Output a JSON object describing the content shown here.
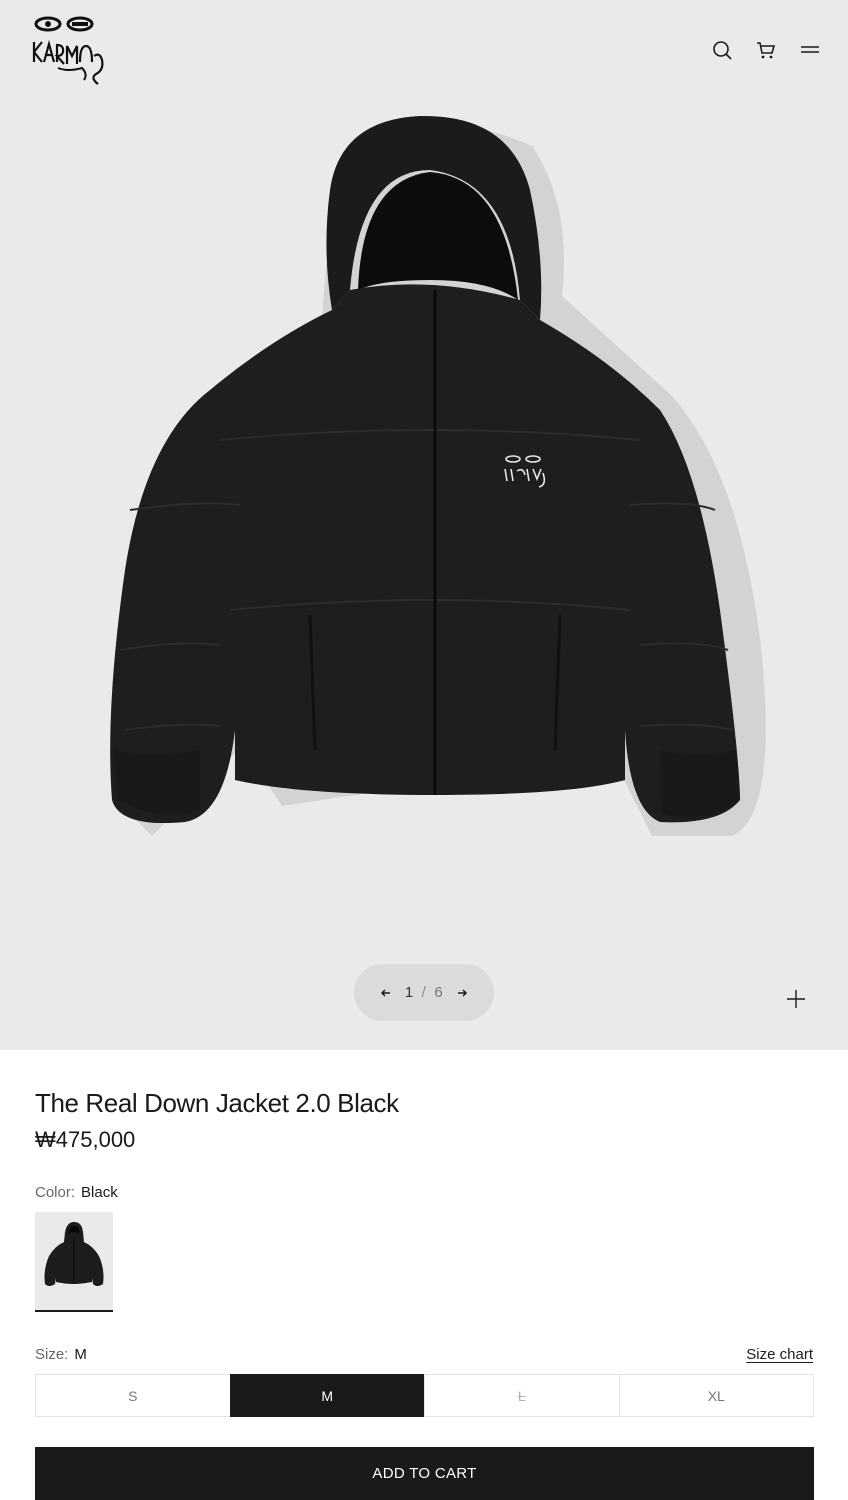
{
  "brand": {
    "logo_text": "KARMA",
    "logo_icon": "eyes-hand-logo-icon"
  },
  "header": {
    "icons": [
      "search-icon",
      "cart-icon",
      "menu-icon"
    ]
  },
  "gallery": {
    "current": "1",
    "separator": "/",
    "total": "6",
    "prev_icon": "arrow-left-icon",
    "next_icon": "arrow-right-icon",
    "zoom_icon": "plus-icon"
  },
  "product": {
    "title": "The Real Down Jacket 2.0 Black",
    "price": "₩475,000"
  },
  "color": {
    "label": "Color:",
    "value": "Black"
  },
  "size": {
    "label": "Size:",
    "value": "M",
    "chart_link": "Size chart",
    "options": [
      {
        "label": "S",
        "state": "available"
      },
      {
        "label": "M",
        "state": "selected"
      },
      {
        "label": "L",
        "state": "sold-out"
      },
      {
        "label": "XL",
        "state": "available"
      }
    ]
  },
  "cta": {
    "add_to_cart": "ADD TO CART"
  },
  "colors": {
    "accent": "#1a1a1a",
    "hero_bg": "#ebeae8"
  }
}
